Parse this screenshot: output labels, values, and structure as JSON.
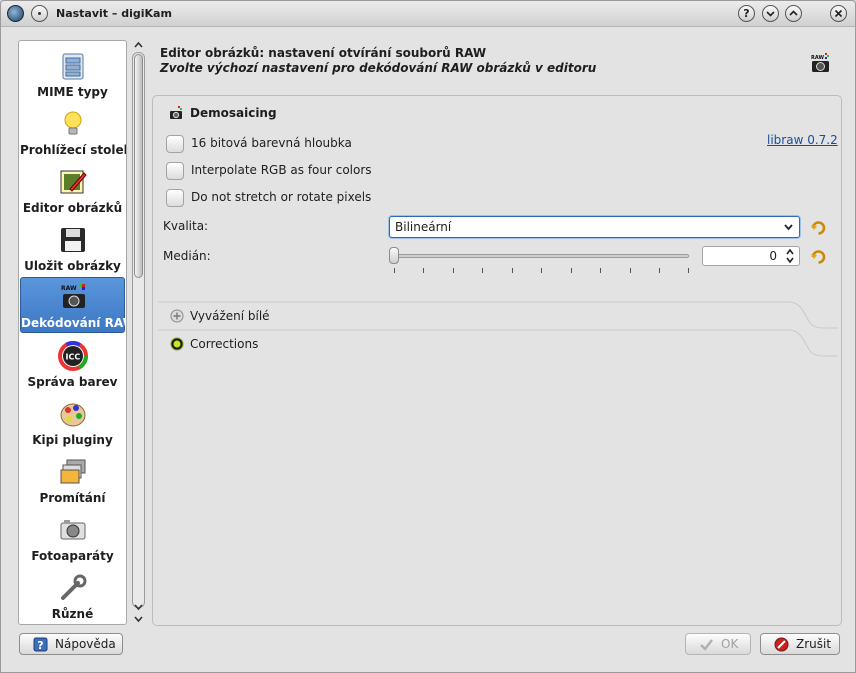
{
  "window": {
    "title": "Nastavit – digiKam",
    "buttons": {
      "help": "?",
      "minimize": "⌄",
      "maximize": "⌃",
      "close": "✕"
    }
  },
  "sidebar": {
    "items": [
      {
        "label": "MIME typy",
        "icon": "mime-types-icon"
      },
      {
        "label": "Prohlížecí stolek",
        "icon": "lightbulb-icon"
      },
      {
        "label": "Editor obrázků",
        "icon": "image-editor-icon"
      },
      {
        "label": "Uložit obrázky",
        "icon": "floppy-disk-icon"
      },
      {
        "label": "Dekódování RAW",
        "icon": "raw-camera-icon",
        "active": true
      },
      {
        "label": "Správa barev",
        "icon": "icc-color-icon"
      },
      {
        "label": "Kipi pluginy",
        "icon": "plugins-icon"
      },
      {
        "label": "Promítání",
        "icon": "slideshow-icon"
      },
      {
        "label": "Fotoaparáty",
        "icon": "camera-icon"
      },
      {
        "label": "Různé",
        "icon": "tools-icon"
      }
    ]
  },
  "header": {
    "title": "Editor obrázků: nastavení otvírání souborů RAW",
    "subtitle": "Zvolte výchozí nastavení pro dekódování RAW obrázků v editoru"
  },
  "demosaicing": {
    "section_title": "Demosaicing",
    "library_link": "libraw 0.7.2",
    "checkboxes": [
      {
        "label": "16 bitová barevná hloubka",
        "checked": false
      },
      {
        "label": "Interpolate RGB as four colors",
        "checked": false
      },
      {
        "label": "Do not stretch or rotate pixels",
        "checked": false
      }
    ],
    "quality_label": "Kvalita:",
    "quality_value": "Bilineární",
    "median_label": "Medián:",
    "median_value": "0",
    "median_slider_fraction": 0
  },
  "sections": {
    "white_balance": "Vyvážení bílé",
    "corrections": "Corrections"
  },
  "footer": {
    "help": "Nápověda",
    "ok": "OK",
    "cancel": "Zrušit"
  },
  "colors": {
    "accent": "#3c78c4",
    "link": "#1b4c9a",
    "cancel_icon": "#c8241e"
  }
}
